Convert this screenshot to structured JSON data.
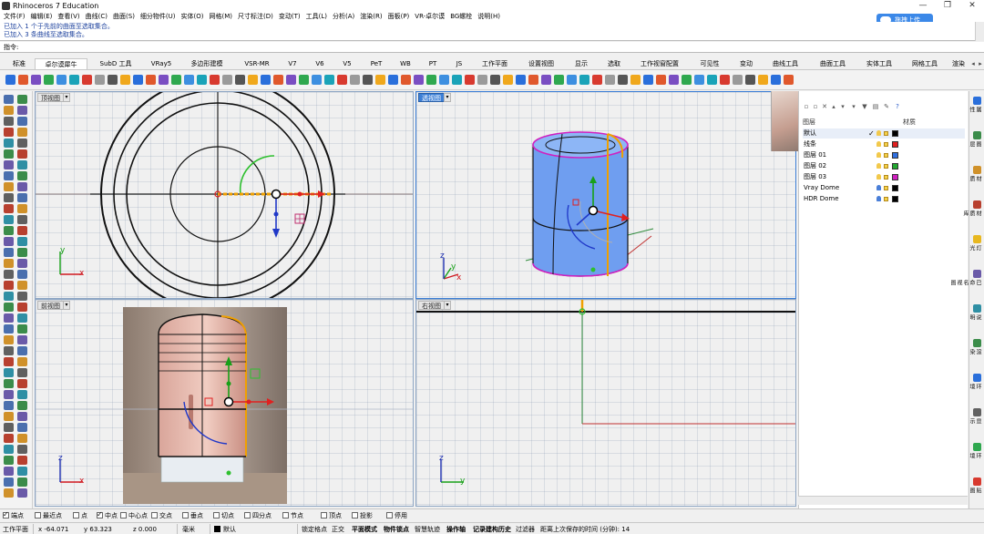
{
  "window": {
    "title": "Rhinoceros 7 Education",
    "controls": [
      "—",
      "❐",
      "✕"
    ]
  },
  "menu": [
    "文件(F)",
    "编辑(E)",
    "查看(V)",
    "曲线(C)",
    "曲面(S)",
    "细分物件(U)",
    "实体(O)",
    "网格(M)",
    "尺寸标注(D)",
    "变动(T)",
    "工具(L)",
    "分析(A)",
    "渲染(R)",
    "面板(P)",
    "VR-卓尔谟",
    "BG螺栓",
    "说明(H)"
  ],
  "upload_button": "拖拽上传",
  "command": {
    "history": [
      "已加入 1 个于先前的曲面至选取集合。",
      "已加入 3 条曲线至选取集合。"
    ],
    "prompt": "指令:"
  },
  "tabs": {
    "items": [
      "标准",
      "卓尔谟犀牛",
      "SubD 工具",
      "VRay5",
      "多边形建模",
      "VSR-MR",
      "V7",
      "V6",
      "V5",
      "PeT",
      "WB",
      "PT",
      "JS",
      "工作平面",
      "设置视图",
      "显示",
      "选取",
      "工作视窗配置",
      "可见性",
      "变动",
      "曲线工具",
      "曲面工具",
      "实体工具",
      "网格工具",
      "渲染"
    ],
    "active_index": 1
  },
  "viewports": {
    "top": {
      "title": "顶视图",
      "axis_x": "x",
      "axis_y": "y"
    },
    "perspective": {
      "title": "透视图",
      "axis_x": "x",
      "axis_y": "y",
      "axis_z": "z"
    },
    "front": {
      "title": "前视图",
      "axis_x": "x",
      "axis_z": "z"
    },
    "right": {
      "title": "右视图",
      "axis_y": "y",
      "axis_z": "z"
    }
  },
  "layers": {
    "header": [
      "图层",
      "材质"
    ],
    "rows": [
      {
        "name": "默认",
        "current": "✓",
        "color": "#000000",
        "bulb": "#f2c94c"
      },
      {
        "name": "线条",
        "current": "",
        "color": "#e02020",
        "bulb": "#f2c94c"
      },
      {
        "name": "图层 01",
        "current": "",
        "color": "#2f6fe0",
        "bulb": "#f2c94c"
      },
      {
        "name": "图层 02",
        "current": "",
        "color": "#22a830",
        "bulb": "#f2c94c"
      },
      {
        "name": "图层 03",
        "current": "",
        "color": "#d020c0",
        "bulb": "#f2c94c"
      },
      {
        "name": "Vray Dome",
        "current": "",
        "color": "#000000",
        "bulb": "#4a7fd8"
      },
      {
        "name": "HDR Dome",
        "current": "",
        "color": "#000000",
        "bulb": "#4a7fd8"
      }
    ]
  },
  "side_tabs": [
    "属性",
    "图层",
    "材质",
    "材质库",
    "灯光",
    "已命名视图",
    "说明",
    "渲染",
    "环境",
    "显示",
    "环境",
    "贴图"
  ],
  "osnap": [
    {
      "label": "端点",
      "on": true
    },
    {
      "label": "最近点",
      "on": false
    },
    {
      "label": "点",
      "on": false
    },
    {
      "label": "中点",
      "on": true
    },
    {
      "label": "中心点",
      "on": false
    },
    {
      "label": "交点",
      "on": false
    },
    {
      "label": "垂点",
      "on": false
    },
    {
      "label": "切点",
      "on": false
    },
    {
      "label": "四分点",
      "on": false
    },
    {
      "label": "节点",
      "on": false
    },
    {
      "label": "顶点",
      "on": false
    },
    {
      "label": "投影",
      "on": false
    },
    {
      "label": "停用",
      "on": false
    }
  ],
  "status": {
    "cplane": "工作平面",
    "x": "x -64.071",
    "y": "y 63.323",
    "z": "z 0.000",
    "units": "毫米",
    "layer": "默认",
    "toggles": [
      "锁定格点",
      "正交",
      "平面模式",
      "物件锁点",
      "智慧轨迹",
      "操作轴",
      "记录建构历史",
      "过滤器"
    ],
    "bold_toggles": [
      "平面模式",
      "物件锁点",
      "操作轴",
      "记录建构历史"
    ],
    "save_info": "距离上次保存的时间 (分钟): 14"
  }
}
